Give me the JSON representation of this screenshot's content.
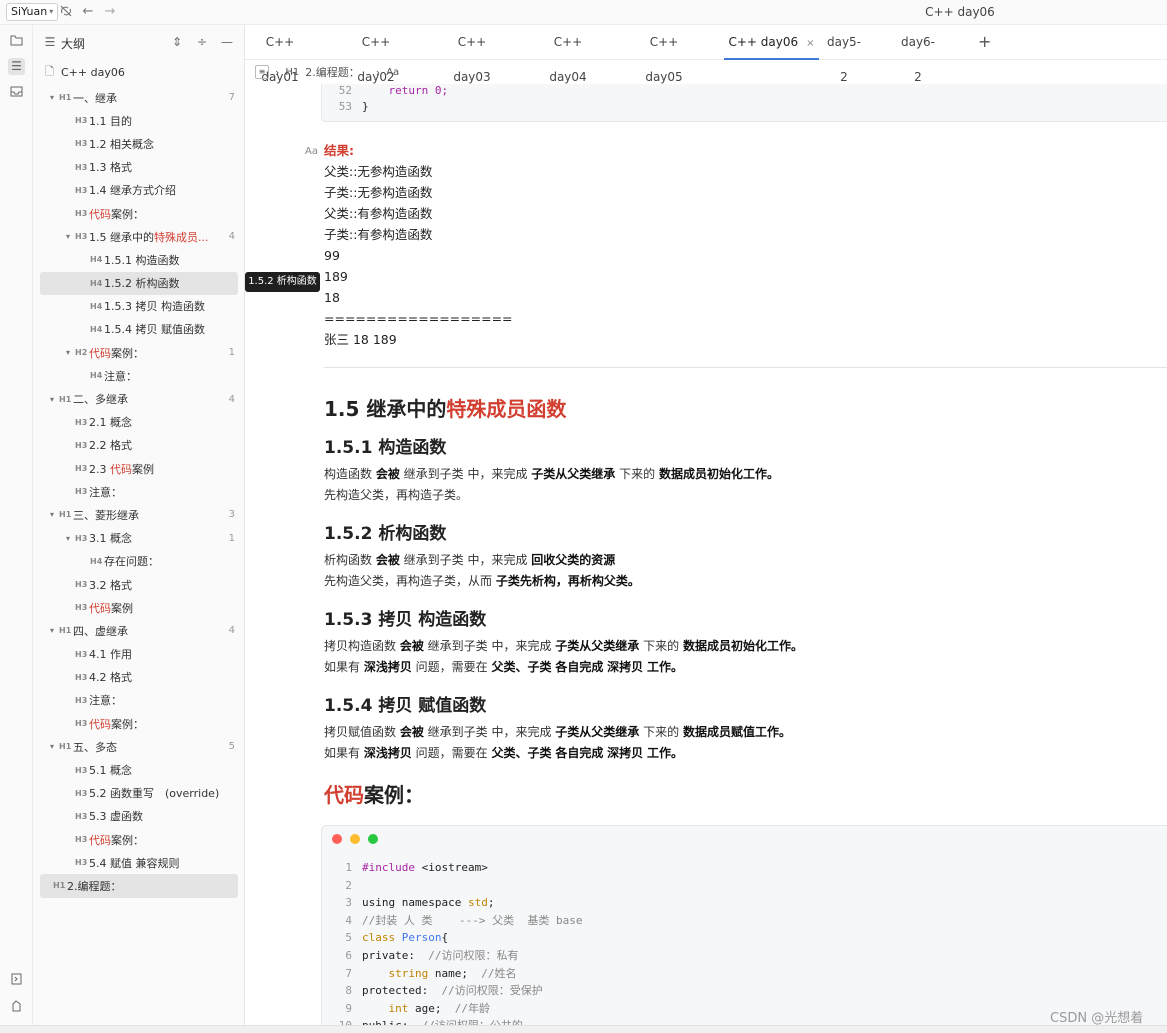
{
  "topbar": {
    "workspace": "SiYuan",
    "window_title": "C++ day06",
    "icons": [
      "sync-off-icon",
      "back-arrow-icon",
      "forward-arrow-icon"
    ]
  },
  "rail": {
    "icons": [
      "file-tree-icon",
      "outline-icon",
      "inbox-icon",
      "bookmark-icon",
      "tag-icon"
    ]
  },
  "outline": {
    "title": "大纲",
    "doc_title": "C++ day06",
    "rows": [
      {
        "level": 1,
        "tag": "H1",
        "label": "一、继承",
        "arrow": true,
        "count": "7"
      },
      {
        "level": 2,
        "tag": "H3",
        "label": "1.1 目的"
      },
      {
        "level": 2,
        "tag": "H3",
        "label": "1.2 相关概念"
      },
      {
        "level": 2,
        "tag": "H3",
        "label": "1.3 格式"
      },
      {
        "level": 2,
        "tag": "H3",
        "label": "1.4 继承方式介绍"
      },
      {
        "level": 2,
        "tag": "H3",
        "label_red": "代码",
        "label_rest": "案例："
      },
      {
        "level": 2,
        "tag": "H3",
        "label": "1.5 继承中的",
        "label_red_tail": "特殊成员...",
        "arrow": true,
        "count": "4"
      },
      {
        "level": 3,
        "tag": "H4",
        "label": "1.5.1 构造函数"
      },
      {
        "level": 3,
        "tag": "H4",
        "label": "1.5.2 析构函数",
        "selected": true
      },
      {
        "level": 3,
        "tag": "H4",
        "label": "1.5.3 拷贝 构造函数"
      },
      {
        "level": 3,
        "tag": "H4",
        "label": "1.5.4 拷贝 赋值函数"
      },
      {
        "level": 2,
        "tag": "H2",
        "label_red": "代码",
        "label_rest": "案例：",
        "arrow": true,
        "count": "1"
      },
      {
        "level": 3,
        "tag": "H4",
        "label": "注意："
      },
      {
        "level": 1,
        "tag": "H1",
        "label": "二、多继承",
        "arrow": true,
        "count": "4"
      },
      {
        "level": 2,
        "tag": "H3",
        "label": "2.1 概念"
      },
      {
        "level": 2,
        "tag": "H3",
        "label": "2.2 格式"
      },
      {
        "level": 2,
        "tag": "H3",
        "label": "2.3 ",
        "label_red_tail": "代码",
        "label_after": "案例"
      },
      {
        "level": 2,
        "tag": "H3",
        "label": "注意："
      },
      {
        "level": 1,
        "tag": "H1",
        "label": "三、菱形继承",
        "arrow": true,
        "count": "3"
      },
      {
        "level": 2,
        "tag": "H3",
        "label": "3.1 概念",
        "arrow": true,
        "count": "1"
      },
      {
        "level": 3,
        "tag": "H4",
        "label": "存在问题："
      },
      {
        "level": 2,
        "tag": "H3",
        "label": "3.2 格式"
      },
      {
        "level": 2,
        "tag": "H3",
        "label_red": "代码",
        "label_rest": "案例"
      },
      {
        "level": 1,
        "tag": "H1",
        "label": "四、虚继承",
        "arrow": true,
        "count": "4"
      },
      {
        "level": 2,
        "tag": "H3",
        "label": "4.1 作用"
      },
      {
        "level": 2,
        "tag": "H3",
        "label": "4.2 格式"
      },
      {
        "level": 2,
        "tag": "H3",
        "label": "注意："
      },
      {
        "level": 2,
        "tag": "H3",
        "label_red": "代码",
        "label_rest": "案例："
      },
      {
        "level": 1,
        "tag": "H1",
        "label": "五、多态",
        "arrow": true,
        "count": "5"
      },
      {
        "level": 2,
        "tag": "H3",
        "label": "5.1 概念"
      },
      {
        "level": 2,
        "tag": "H3",
        "label": "5.2 函数重写　(override)"
      },
      {
        "level": 2,
        "tag": "H3",
        "label": "5.3 虚函数"
      },
      {
        "level": 2,
        "tag": "H3",
        "label_red": "代码",
        "label_rest": "案例："
      },
      {
        "level": 2,
        "tag": "H3",
        "label": "5.4 赋值 兼容规则"
      },
      {
        "level": 1,
        "tag": "H1",
        "label": "2.编程题：",
        "selected": true,
        "root": true
      }
    ]
  },
  "tooltip": "1.5.2 析构函数",
  "tabs": [
    {
      "label": "C++ day01"
    },
    {
      "label": "C++ day02"
    },
    {
      "label": "C++ day03"
    },
    {
      "label": "C++ day04"
    },
    {
      "label": "C++ day05"
    },
    {
      "label": "C++ day06",
      "active": true
    },
    {
      "label": "day5-2"
    },
    {
      "label": "day6-2"
    }
  ],
  "breadcrumb": {
    "heading_tag": "H1",
    "heading": "2.编程题：",
    "block": "Aa"
  },
  "code_top": [
    {
      "n": "52",
      "code": "return 0;"
    },
    {
      "n": "53",
      "code": "}"
    }
  ],
  "result": {
    "aa": "Aa",
    "label": "结果:",
    "lines": [
      "父类::无参构造函数",
      "子类::无参构造函数",
      "父类::有参构造函数",
      "子类::有参构造函数",
      "99",
      "189",
      "18",
      "==================",
      "张三 18 189"
    ]
  },
  "sections": {
    "h15_prefix": "1.5 继承中的",
    "h15_red": "特殊成员函数",
    "h151": "1.5.1 构造函数",
    "h151_p1": [
      "构造函数 ",
      "会被",
      " 继承到子类 中，来完成 ",
      "子类从父类继承",
      " 下来的 ",
      "数据成员初始化工作。"
    ],
    "h151_p2": "先构造父类，再构造子类。",
    "h152": "1.5.2 析构函数",
    "h152_p1": [
      "析构函数 ",
      "会被",
      " 继承到子类 中，来完成 ",
      "回收父类的资源"
    ],
    "h152_p2": [
      "先构造父类，再构造子类，从而 ",
      "子类",
      "先析构",
      "，",
      "再析构",
      "父类。"
    ],
    "h153": "1.5.3 拷贝 构造函数",
    "h153_p1": [
      "拷贝构造函数 ",
      "会被",
      " 继承到子类 中，来完成 ",
      "子类从父类继承",
      " 下来的 ",
      "数据成员初始化工作。"
    ],
    "h153_p2": [
      "如果有 ",
      "深浅拷贝",
      " 问题，需要在 ",
      "父类、子类",
      " ",
      "各自完成",
      " ",
      "深拷贝",
      " ",
      "工作。"
    ],
    "h154": "1.5.4 拷贝 赋值函数",
    "h154_p1": [
      "拷贝赋值函数 ",
      "会被",
      " 继承到子类 中，来完成 ",
      "子类从父类继承",
      " 下来的 ",
      "数据成员赋值工作。"
    ],
    "h154_p2": [
      "如果有 ",
      "深浅拷贝",
      " 问题，需要在 ",
      "父类、子类",
      " ",
      "各自完成",
      " ",
      "深拷贝",
      " ",
      "工作。"
    ],
    "code_h_red": "代码",
    "code_h_rest": "案例："
  },
  "code_main": [
    {
      "n": "1",
      "parts": [
        [
          "kw",
          "#include "
        ],
        [
          "",
          "<iostream>"
        ]
      ]
    },
    {
      "n": "2",
      "parts": [
        [
          "",
          ""
        ]
      ]
    },
    {
      "n": "3",
      "parts": [
        [
          "",
          "using namespace "
        ],
        [
          "ty",
          "std"
        ],
        [
          "",
          ";"
        ]
      ]
    },
    {
      "n": "4",
      "parts": [
        [
          "cm",
          "//封装 人 类    ---> 父类  基类 base"
        ]
      ]
    },
    {
      "n": "5",
      "parts": [
        [
          "kw2",
          "class "
        ],
        [
          "cls",
          "Person"
        ],
        [
          "",
          "{"
        ]
      ]
    },
    {
      "n": "6",
      "parts": [
        [
          "",
          "private:  "
        ],
        [
          "cm",
          "//访问权限：私有"
        ]
      ]
    },
    {
      "n": "7",
      "parts": [
        [
          "",
          "    "
        ],
        [
          "kw2",
          "string"
        ],
        [
          "",
          " name;  "
        ],
        [
          "cm",
          "//姓名"
        ]
      ]
    },
    {
      "n": "8",
      "parts": [
        [
          "",
          "protected:  "
        ],
        [
          "cm",
          "//访问权限：受保护"
        ]
      ]
    },
    {
      "n": "9",
      "parts": [
        [
          "",
          "    "
        ],
        [
          "kw2",
          "int"
        ],
        [
          "",
          " age;  "
        ],
        [
          "cm",
          "//年龄"
        ]
      ]
    },
    {
      "n": "10",
      "parts": [
        [
          "",
          "public:  "
        ],
        [
          "cm",
          "//访问权限：公共的"
        ]
      ]
    }
  ],
  "dot_colors": [
    "#ff5f57",
    "#febc2e",
    "#28c840"
  ],
  "colors": {
    "accent": "#3f7bd9",
    "red": "#d23f31"
  },
  "watermark": "CSDN @光想着"
}
